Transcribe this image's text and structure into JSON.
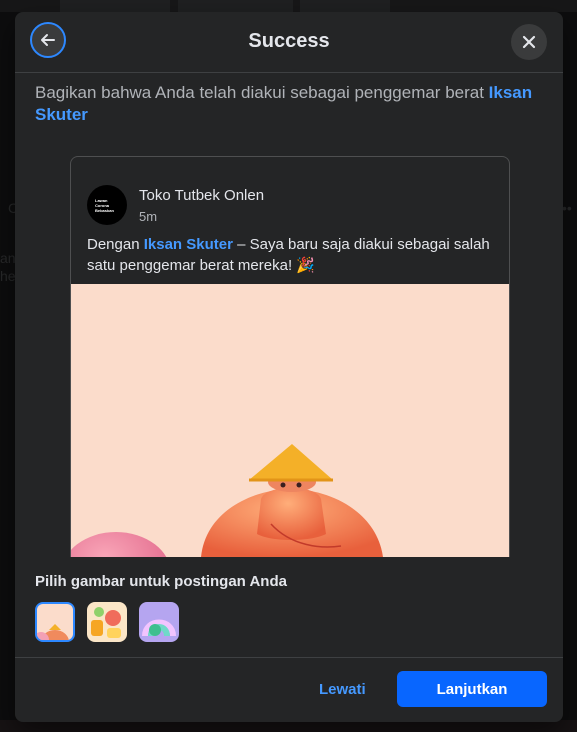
{
  "dialog": {
    "title": "Success",
    "intro_prefix": "Bagikan bahwa Anda telah diakui sebagai penggemar berat ",
    "intro_link": "Iksan Skuter"
  },
  "post": {
    "author": "Toko Tutbek Onlen",
    "timestamp": "5m",
    "text_prefix": "Dengan ",
    "text_link": "Iksan Skuter",
    "text_suffix": " – Saya baru saja diakui sebagai salah satu penggemar berat mereka! 🎉",
    "avatar_lines": [
      "Lawan",
      "Corona",
      "Bebaskan"
    ]
  },
  "picker": {
    "label": "Pilih gambar untuk postingan Anda",
    "images": [
      "pink-figure",
      "colorful-stickers",
      "purple-rainbow"
    ],
    "selected_index": 0
  },
  "footer": {
    "skip_label": "Lewati",
    "continue_label": "Lanjutkan"
  },
  "background": {
    "top_text": "should be rigorous and"
  },
  "colors": {
    "accent": "#0866ff",
    "link": "#4599ff",
    "modal_bg": "#242526",
    "image_bg": "#fbdccb"
  }
}
